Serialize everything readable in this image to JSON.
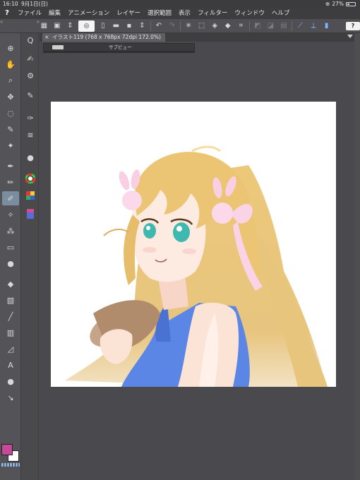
{
  "status": {
    "time": "16:10",
    "date": "9月1日(日)",
    "battery": "27%"
  },
  "menu": [
    "ファイル",
    "編集",
    "アニメーション",
    "レイヤー",
    "選択範囲",
    "表示",
    "フィルター",
    "ウィンドウ",
    "ヘルプ"
  ],
  "document": {
    "tab_title": "イラスト119 (768 x 768px 72dpi 172.0%)"
  },
  "subview": {
    "title": "サブビュー"
  },
  "colors": {
    "main": "#c8489a",
    "sub": "#ffffff",
    "accent": "#7fb4ff"
  },
  "tools_left": [
    "zoom-icon",
    "hand-icon",
    "magnifier-icon",
    "move-icon",
    "lasso-icon",
    "eyedropper-icon",
    "auto-select-icon",
    "pen-icon",
    "pencil-icon",
    "brush-icon",
    "airbrush-icon",
    "decoration-icon",
    "eraser-icon",
    "blend-icon",
    "fill-icon",
    "gradient-icon",
    "figure-icon",
    "frame-icon",
    "ruler-icon",
    "text-icon",
    "balloon-icon",
    "correct-line-icon"
  ],
  "tools_right": [
    "navigator-icon",
    "layer-property-icon",
    "tool-property-icon",
    "sub-tool-detail-icon",
    "brush-size-icon",
    "layer-icon",
    "search-layer-icon",
    "color-wheel-icon",
    "color-set-icon",
    "intermediate-color-icon"
  ],
  "command": [
    "grid-menu-icon",
    "new-icon",
    "open-icon",
    "save-icon",
    "undo-icon",
    "redo-icon",
    "transform-icon",
    "clear-icon",
    "fill-icon",
    "crop-icon",
    "snap-icon",
    "help-icon"
  ]
}
